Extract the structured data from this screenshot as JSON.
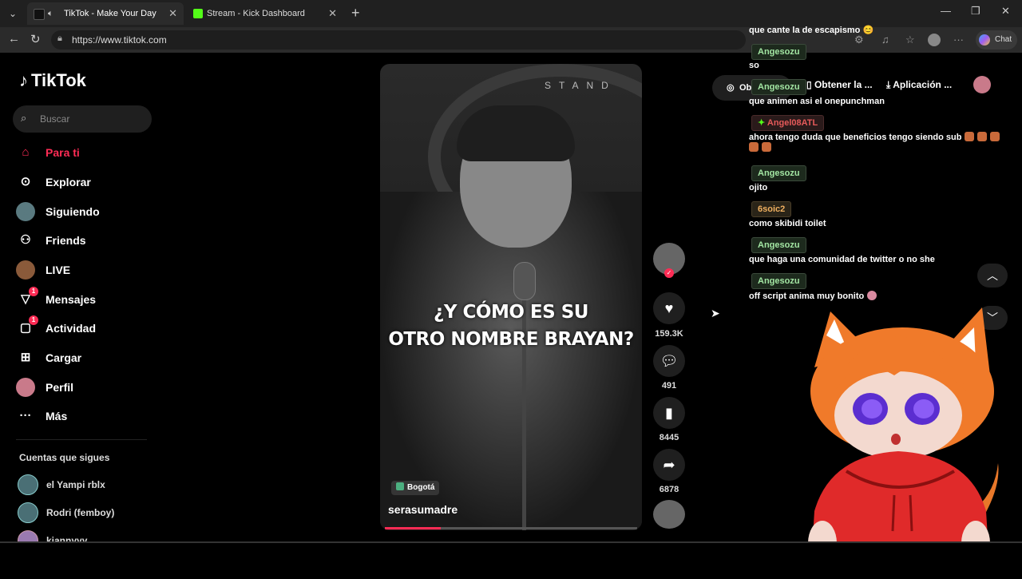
{
  "browser": {
    "tabs": [
      {
        "title": "TikTok - Make Your Day",
        "active": true,
        "fav_color": "#111111"
      },
      {
        "title": "Stream - Kick Dashboard",
        "active": false,
        "fav_color": "#53fc18"
      }
    ],
    "url": "https://www.tiktok.com",
    "chat_label": "Chat"
  },
  "sidebar": {
    "logo": "TikTok",
    "search_placeholder": "Buscar",
    "items": [
      {
        "label": "Para ti",
        "icon": "home-icon",
        "glyph": "⌂",
        "active": true
      },
      {
        "label": "Explorar",
        "icon": "compass-icon",
        "glyph": "⊙"
      },
      {
        "label": "Siguiendo",
        "icon": "following-avatar-icon",
        "glyph": "☺"
      },
      {
        "label": "Friends",
        "icon": "friends-icon",
        "glyph": "⚇"
      },
      {
        "label": "LIVE",
        "icon": "live-avatar-icon",
        "glyph": "●"
      },
      {
        "label": "Mensajes",
        "icon": "messages-icon",
        "glyph": "▽",
        "badge": "1"
      },
      {
        "label": "Actividad",
        "icon": "activity-icon",
        "glyph": "▢",
        "badge": "1"
      },
      {
        "label": "Cargar",
        "icon": "upload-icon",
        "glyph": "⊞"
      },
      {
        "label": "Perfil",
        "icon": "profile-avatar-icon",
        "glyph": "●"
      },
      {
        "label": "Más",
        "icon": "more-icon",
        "glyph": "···"
      }
    ],
    "following_title": "Cuentas que sigues",
    "following": [
      "el Yampi rblx",
      "Rodri (femboy)",
      "kiannyyy"
    ]
  },
  "video": {
    "caption_line1": "¿Y CÓMO ES SU",
    "caption_line2": "OTRO NOMBRE BRAYAN?",
    "sign_text": "STAND",
    "location": "Bogotá",
    "username": "serasumadre",
    "progress": 0.22
  },
  "actions": {
    "likes": "159.3K",
    "comments": "491",
    "saves": "8445",
    "shares": "6878"
  },
  "topbar": {
    "chip": "Ob",
    "get_app": "Obtener la ...",
    "app": "Aplicación ..."
  },
  "chat": {
    "messages": [
      {
        "user": "",
        "text": "que cante la de escapismo 😊"
      },
      {
        "user": "Angesozu",
        "text": "so"
      },
      {
        "user": "Angesozu",
        "text": "que animen asi el onepunchman"
      },
      {
        "user": "Angel08ATL",
        "text": "ahora tengo duda que beneficios tengo siendo sub"
      },
      {
        "user": "Angesozu",
        "text": "ojito"
      },
      {
        "user": "6soic2",
        "text": "como skibidi toilet"
      },
      {
        "user": "Angesozu",
        "text": "que haga una comunidad de twitter o no she"
      },
      {
        "user": "Angesozu",
        "text": "off script anima muy bonito"
      }
    ]
  },
  "colors": {
    "accent": "#fe2c55",
    "chat_green": "#a3e6a3",
    "chat_red": "#e65a5a"
  }
}
